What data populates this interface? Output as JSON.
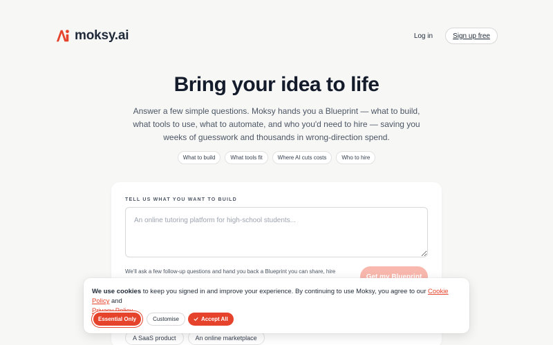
{
  "brand": {
    "name": "moksy.ai",
    "accent": "#e5432c"
  },
  "nav": {
    "login_label": "Log in",
    "signup_label": "Sign up free"
  },
  "hero": {
    "title": "Bring your idea to life",
    "subtitle": "Answer a few simple questions. Moksy hands you a Blueprint — what to build, what tools to use, what to automate, and who you'd need to hire — saving you weeks of guesswork and thousands in wrong-direction spend."
  },
  "topics": [
    "What to build",
    "What tools fit",
    "Where AI cuts costs",
    "Who to hire"
  ],
  "form": {
    "label": "TELL US WHAT YOU WANT TO BUILD",
    "placeholder": "An online tutoring platform for high-school students...",
    "helper": "We'll ask a few follow-up questions and hand you back a Blueprint you can share, hire",
    "cta_label": "Get my Blueprint",
    "examples": [
      "A SaaS product",
      "An online marketplace"
    ]
  },
  "cookie": {
    "lead_bold": "We use cookies",
    "text_1": " to keep you signed in and improve your experience. By continuing to use Moksy, you agree to our ",
    "cookie_policy_link": "Cookie Policy",
    "text_2": " and ",
    "privacy_policy_link": "Privacy Policy",
    "text_3": ".",
    "essential_label": "Essential Only",
    "customise_label": "Customise",
    "accept_label": "Accept All"
  }
}
